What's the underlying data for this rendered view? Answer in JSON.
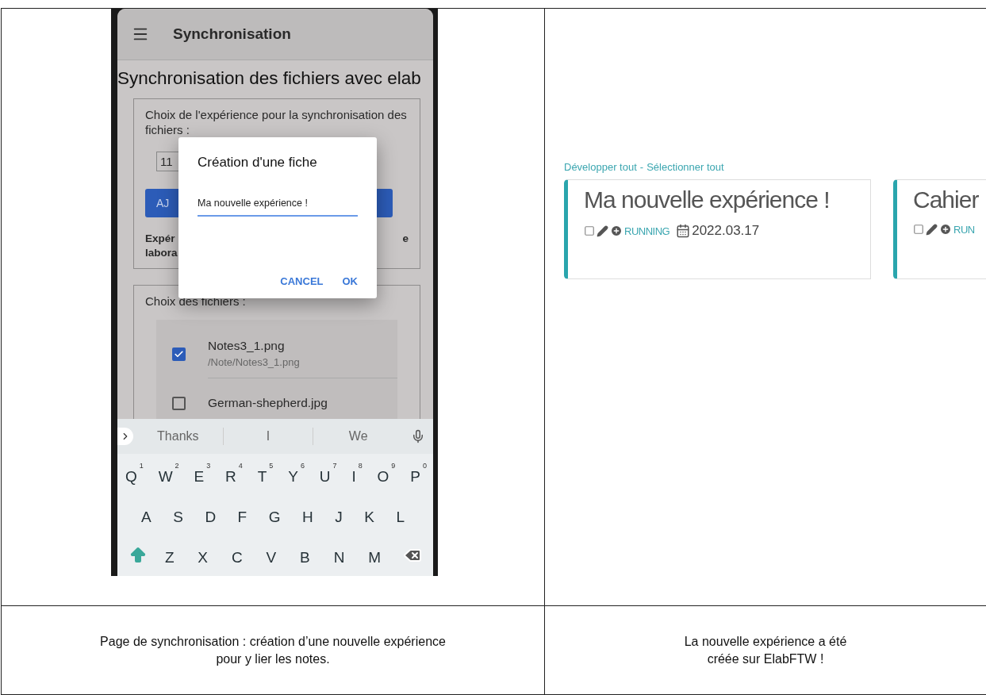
{
  "left_panel": {
    "phone": {
      "app_bar_title": "Synchronisation",
      "page_title": "Synchronisation des fichiers avec elab",
      "experience_section": {
        "label": "Choix de l'expérience pour la synchronisation des fichiers :",
        "field_value": "11",
        "button_label": "AJ",
        "info_lines": [
          "Expér",
          "labora"
        ],
        "info_tail": "e"
      },
      "files_section": {
        "label": "Choix des fichiers :",
        "files": [
          {
            "name": "Notes3_1.png",
            "path": "/Note/Notes3_1.png",
            "checked": true
          },
          {
            "name": "German-shepherd.jpg",
            "checked": false
          }
        ]
      },
      "dialog": {
        "title": "Création d'une fiche",
        "value": "Ma nouvelle expérience !",
        "buttons": [
          "CANCEL",
          "OK"
        ]
      },
      "keyboard": {
        "suggestions": [
          "Thanks",
          "I",
          "We"
        ],
        "rows": [
          [
            {
              "key": "Q",
              "hint": "1"
            },
            {
              "key": "W",
              "hint": "2"
            },
            {
              "key": "E",
              "hint": "3"
            },
            {
              "key": "R",
              "hint": "4"
            },
            {
              "key": "T",
              "hint": "5"
            },
            {
              "key": "Y",
              "hint": "6"
            },
            {
              "key": "U",
              "hint": "7"
            },
            {
              "key": "I",
              "hint": "8"
            },
            {
              "key": "O",
              "hint": "9"
            },
            {
              "key": "P",
              "hint": "0"
            }
          ],
          [
            {
              "key": "A"
            },
            {
              "key": "S"
            },
            {
              "key": "D"
            },
            {
              "key": "F"
            },
            {
              "key": "G"
            },
            {
              "key": "H"
            },
            {
              "key": "J"
            },
            {
              "key": "K"
            },
            {
              "key": "L"
            }
          ],
          [
            {
              "kind": "shift"
            },
            {
              "key": "Z"
            },
            {
              "key": "X"
            },
            {
              "key": "C"
            },
            {
              "key": "V"
            },
            {
              "key": "B"
            },
            {
              "key": "N"
            },
            {
              "key": "M"
            },
            {
              "kind": "backspace"
            }
          ]
        ]
      }
    },
    "caption": "Page de synchronisation : création d’une nouvelle expérience pour y lier les notes."
  },
  "right_panel": {
    "links": [
      "Développer tout",
      "Sélectionner tout"
    ],
    "separator": "-",
    "cards": [
      {
        "title": "Ma nouvelle expérience !",
        "status": "RUNNING",
        "date": "2022.03.17"
      },
      {
        "title": "Cahier",
        "status": "RUN"
      }
    ],
    "caption": "La nouvelle expérience a été créée sur ElabFTW !"
  }
}
